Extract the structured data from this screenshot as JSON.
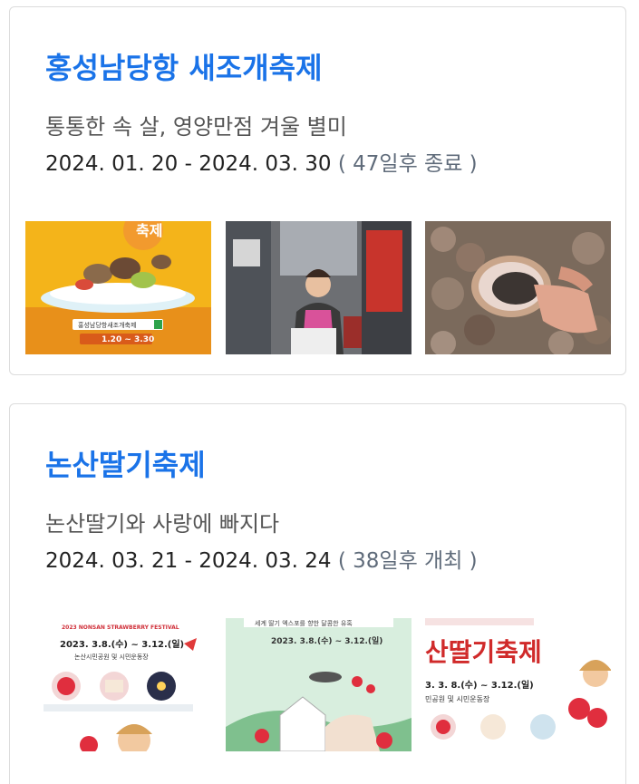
{
  "festivals": [
    {
      "title": "홍성남당항 새조개축제",
      "subtitle": "통통한 속 살, 영양만점 겨울 별미",
      "date_range": "2024. 01. 20 - 2024. 03. 30",
      "status": "( 47일후 종료 )",
      "images": [
        {
          "icon": "festival-poster-image",
          "caption": "홍성남당항새조개축제",
          "dates": "1.20 ~ 3.30",
          "poster_title": "축제"
        },
        {
          "icon": "vendor-photo-image"
        },
        {
          "icon": "shellfish-photo-image"
        }
      ]
    },
    {
      "title": "논산딸기축제",
      "subtitle": "논산딸기와 사랑에 빠지다",
      "date_range": "2024. 03. 21 - 2024. 03. 24",
      "status": "( 38일후 개최 )",
      "images": [
        {
          "icon": "strawberry-poster-image",
          "banner": "2023 NONSAN STRAWBERRY FESTIVAL",
          "dates": "2023. 3.8.(수) ~ 3.12.(일)",
          "venue": "논산시민공원 및 시민운동장"
        },
        {
          "icon": "strawberry-expo-poster-image",
          "banner": "세계 딸기 엑스포를 향한 달콤한 유혹",
          "dates": "2023. 3.8.(수) ~ 3.12.(일)"
        },
        {
          "icon": "strawberry-festival-poster-image",
          "headline": "산딸기축제",
          "dates": "3. 3. 8.(수) ~ 3.12.(일)",
          "venue": "민공원 및 시민운동장"
        }
      ]
    }
  ],
  "colors": {
    "title": "#1a73e8",
    "subtitle": "#555555",
    "date": "#222222",
    "status": "#5f6b7a",
    "border": "#dcdcdc"
  }
}
